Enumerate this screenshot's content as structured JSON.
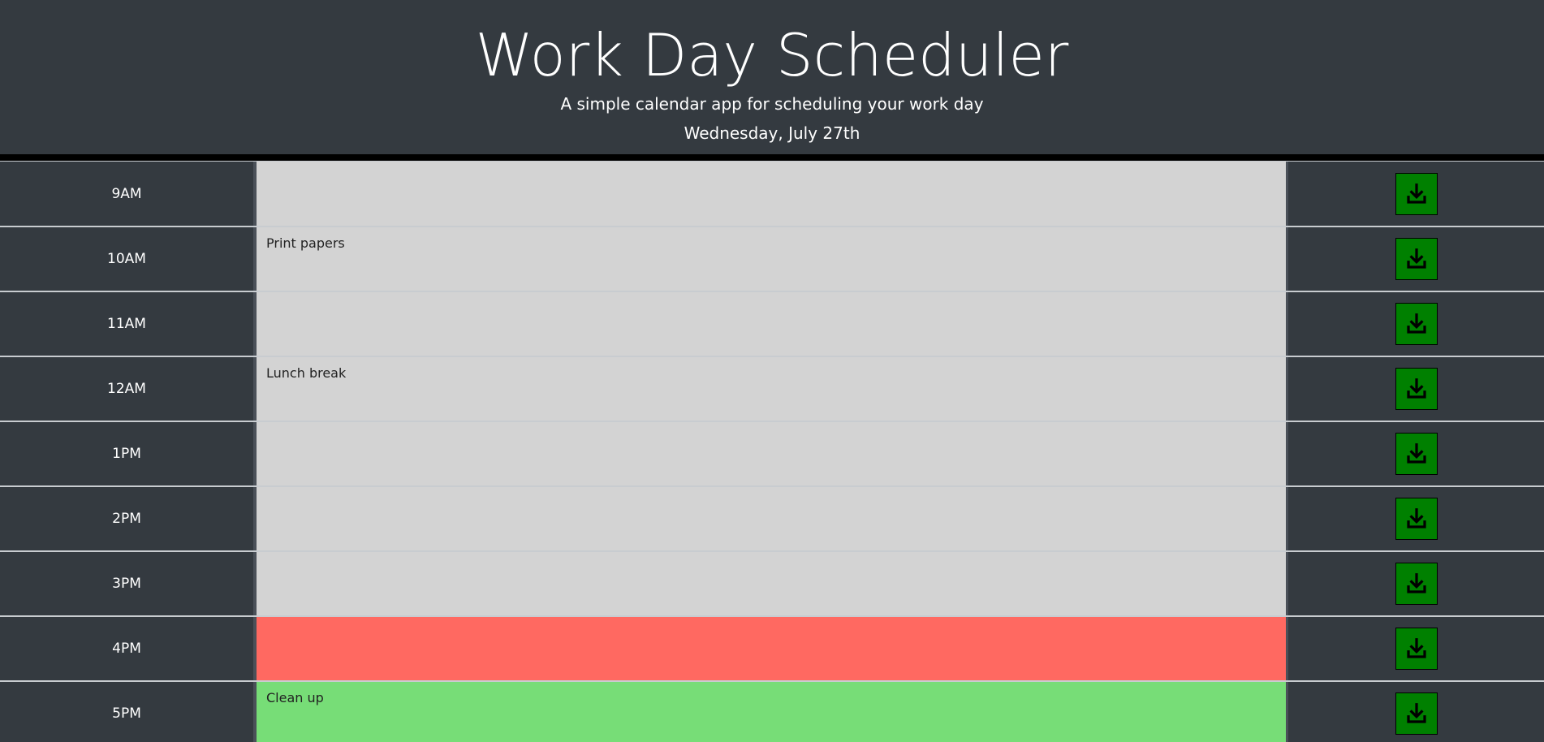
{
  "header": {
    "title": "Work Day Scheduler",
    "subtitle": "A simple calendar app for scheduling your work day",
    "current_day": "Wednesday, July 27th"
  },
  "time_blocks": [
    {
      "hour": "9AM",
      "text": "",
      "status": "past"
    },
    {
      "hour": "10AM",
      "text": "Print papers",
      "status": "past"
    },
    {
      "hour": "11AM",
      "text": "",
      "status": "past"
    },
    {
      "hour": "12AM",
      "text": "Lunch break",
      "status": "past"
    },
    {
      "hour": "1PM",
      "text": "",
      "status": "past"
    },
    {
      "hour": "2PM",
      "text": "",
      "status": "past"
    },
    {
      "hour": "3PM",
      "text": "",
      "status": "past"
    },
    {
      "hour": "4PM",
      "text": "",
      "status": "present"
    },
    {
      "hour": "5PM",
      "text": "Clean up",
      "status": "future"
    }
  ],
  "save_icon": "save-download-icon",
  "colors": {
    "background": "#343a40",
    "past": "#d3d3d3",
    "present": "#ff6961",
    "future": "#77dd77",
    "save_button": "#008000"
  }
}
